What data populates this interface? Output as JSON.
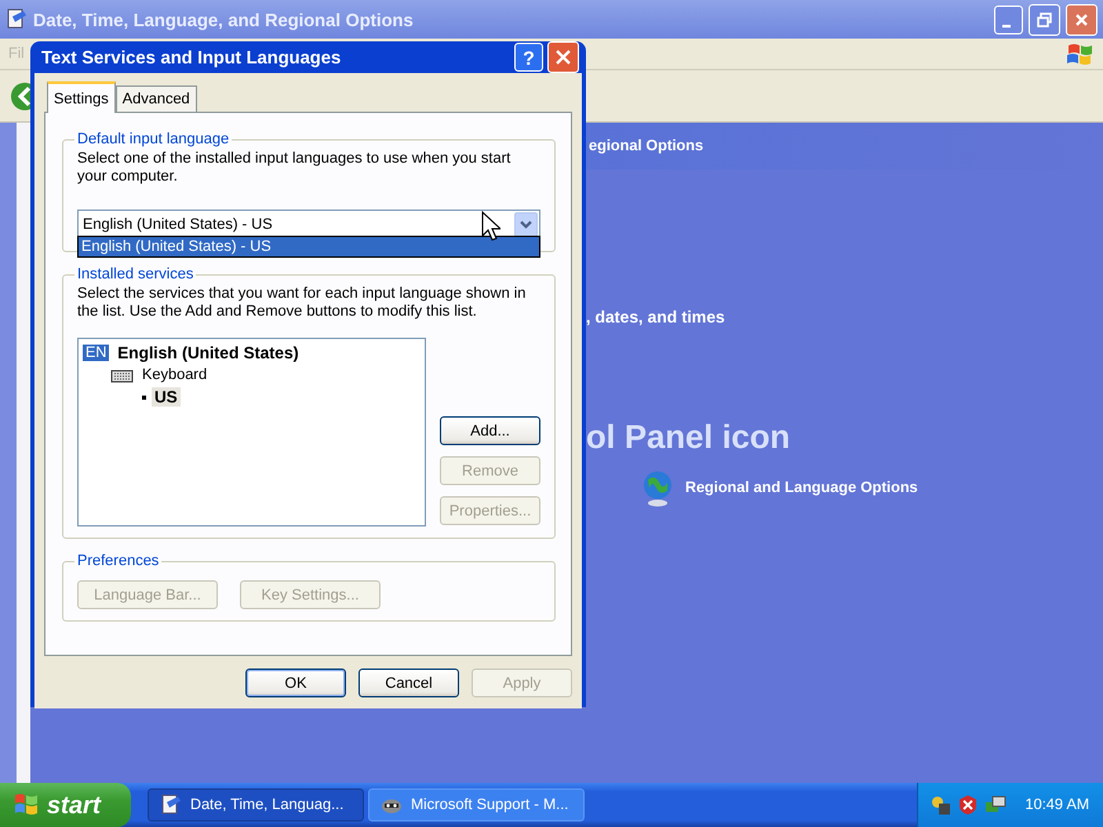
{
  "background_window": {
    "title": "Date, Time, Language, and Regional Options",
    "menu": [
      "Fil"
    ],
    "header": "egional Options",
    "task_text": ", dates, and times",
    "heading": "ol Panel icon",
    "link": "Regional and Language Options"
  },
  "dialog": {
    "title": "Text Services and Input Languages",
    "help_button": "?",
    "tabs": [
      {
        "label": "Settings",
        "selected": true
      },
      {
        "label": "Advanced",
        "selected": false
      }
    ],
    "default_language": {
      "legend": "Default input language",
      "description": "Select one of the installed input languages to use when you start your computer.",
      "value": "English (United States) - US",
      "dropdown_items": [
        {
          "label": "English (United States) - US",
          "selected": true
        }
      ]
    },
    "installed_services": {
      "legend": "Installed services",
      "description": "Select the services that you want for each input language shown in the list. Use the Add and Remove buttons to modify this list.",
      "tree": [
        {
          "badge": "EN",
          "label": "English (United States)",
          "selected": false,
          "children": [
            {
              "label": "Keyboard",
              "selected": false,
              "children": [
                {
                  "label": "US",
                  "selected": true
                }
              ]
            }
          ]
        }
      ],
      "buttons": [
        {
          "label": "Add...",
          "disabled": false
        },
        {
          "label": "Remove",
          "disabled": true
        },
        {
          "label": "Properties...",
          "disabled": true
        }
      ]
    },
    "preferences": {
      "legend": "Preferences",
      "buttons": [
        {
          "label": "Language Bar...",
          "disabled": true
        },
        {
          "label": "Key Settings...",
          "disabled": true
        }
      ]
    },
    "buttons": [
      {
        "label": "OK",
        "disabled": false
      },
      {
        "label": "Cancel",
        "disabled": false
      },
      {
        "label": "Apply",
        "disabled": true
      }
    ]
  },
  "taskbar": {
    "start": "start",
    "tasks": [
      {
        "label": "Date, Time, Languag...",
        "selected": true
      },
      {
        "label": "Microsoft Support - M...",
        "selected": false
      }
    ],
    "clock": "10:49 AM"
  }
}
